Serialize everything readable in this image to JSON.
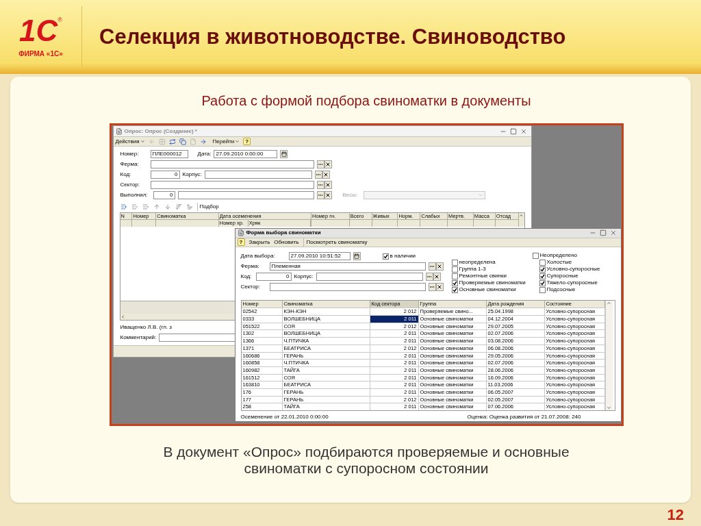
{
  "slide": {
    "logo": {
      "mark": "1С",
      "registered": "®",
      "caption": "ФИРМА «1С»"
    },
    "title": "Селекция в животноводстве. Свиноводство",
    "subtitle": "Работа с формой подбора свиноматки в документы",
    "caption": "В документ «Опрос» подбираются проверяемые и основные свиноматки с супоросном состоянии",
    "page_number": "12"
  },
  "doc": {
    "title": "Опрос: Опрос (Создание) *",
    "actions": "Действия",
    "goto": "Перейти",
    "help": "?",
    "number": {
      "label": "Номер:",
      "value": "ПЛЕ000012"
    },
    "date": {
      "label": "Дата:",
      "value": "27.09.2010  0:00:00"
    },
    "farm": {
      "label": "Ферма:"
    },
    "code": {
      "label": "Код:",
      "value": "0"
    },
    "building": {
      "label": "Корпус:"
    },
    "sector": {
      "label": "Сектор:"
    },
    "performer": {
      "label": "Выполнил:",
      "value": "0"
    },
    "scales": {
      "label": "Весы:",
      "disabled": true
    },
    "selection": "Подбор",
    "columns": [
      {
        "label": "N"
      },
      {
        "label": "Номер"
      },
      {
        "label": "Свиноматка"
      },
      {
        "label": "Дата осеменения",
        "sub": [
          "Номер хр.",
          "Хряк"
        ]
      },
      {
        "label": "Номер гн."
      },
      {
        "label": "Всего"
      },
      {
        "label": "Живых"
      },
      {
        "label": "Норм."
      },
      {
        "label": "Слабых"
      },
      {
        "label": "Мертв."
      },
      {
        "label": "Масса"
      },
      {
        "label": "Отсад"
      }
    ],
    "performer_name": "Иващенко Л.В. (гл. з",
    "comment": {
      "label": "Комментарий:"
    }
  },
  "picker": {
    "title": "Форма выбора свиноматки",
    "help": "?",
    "buttons": [
      "Закрыть",
      "Обновить",
      "Посмотреть свиноматку"
    ],
    "date": {
      "label": "Дата выбора:",
      "value": "27.09.2010 10:51:52"
    },
    "in_stock": {
      "label": "в наличии",
      "checked": true
    },
    "farm": {
      "label": "Ферма:",
      "value": "Племенная"
    },
    "code": {
      "label": "Код:",
      "value": "0"
    },
    "building": {
      "label": "Корпус:"
    },
    "sector": {
      "label": "Сектор:"
    },
    "groups": [
      {
        "label": "неопределена",
        "checked": false
      },
      {
        "label": "Группа 1-3",
        "checked": false
      },
      {
        "label": "Ремонтные свинки",
        "checked": false
      },
      {
        "label": "Проверяемые свиноматки",
        "checked": true
      },
      {
        "label": "Основные свиноматки",
        "checked": true
      }
    ],
    "states": [
      {
        "label": "Неопределено",
        "checked": false
      },
      {
        "label": "Холостые",
        "checked": false
      },
      {
        "label": "Условно-супоросные",
        "checked": true
      },
      {
        "label": "Супоросные",
        "checked": true
      },
      {
        "label": "Тяжело-супоросные",
        "checked": true
      },
      {
        "label": "Подсосные",
        "checked": false
      }
    ],
    "columns": [
      "Номер",
      "Свиноматка",
      "Код сектора",
      "Группа",
      "Дата рождения",
      "Состояние"
    ],
    "rows": [
      {
        "cells": [
          "02542",
          "КЭН-КЭН",
          "2 012",
          "Проверяемые свино...",
          "25.04.1998",
          "Условно-супоросная"
        ],
        "selected": false
      },
      {
        "cells": [
          "0333",
          "ВОЛШЕБНИЦА",
          "2 011",
          "Основные свиноматки",
          "04.12.2004",
          "Условно-супоросная"
        ],
        "selected": true
      },
      {
        "cells": [
          "051522",
          "СОЯ",
          "2 012",
          "Основные свиноматки",
          "29.07.2005",
          "Условно-супоросная"
        ],
        "selected": false
      },
      {
        "cells": [
          "1302",
          "ВОЛШЕБНИЦА",
          "2 011",
          "Основные свиноматки",
          "02.07.2006",
          "Условно-супоросная"
        ],
        "selected": false
      },
      {
        "cells": [
          "1366",
          "Ч.ПТИЧКА",
          "2 011",
          "Основные свиноматки",
          "03.08.2006",
          "Условно-супоросная"
        ],
        "selected": false
      },
      {
        "cells": [
          "1371",
          "БЕАТРИСА",
          "2 012",
          "Основные свиноматки",
          "06.08.2006",
          "Условно-супоросная"
        ],
        "selected": false
      },
      {
        "cells": [
          "160686",
          "ГЕРАНЬ",
          "2 011",
          "Основные свиноматки",
          "29.05.2006",
          "Условно-супоросная"
        ],
        "selected": false
      },
      {
        "cells": [
          "160858",
          "Ч.ПТИЧКА",
          "2 011",
          "Основные свиноматки",
          "02.07.2006",
          "Условно-супоросная"
        ],
        "selected": false
      },
      {
        "cells": [
          "160982",
          "ТАЙГА",
          "2 011",
          "Основные свиноматки",
          "28.06.2006",
          "Условно-супоросная"
        ],
        "selected": false
      },
      {
        "cells": [
          "161512",
          "СОЯ",
          "2 011",
          "Основные свиноматки",
          "16.09.2006",
          "Условно-супоросная"
        ],
        "selected": false
      },
      {
        "cells": [
          "163810",
          "БЕАТРИСА",
          "2 011",
          "Основные свиноматки",
          "11.03.2006",
          "Условно-супоросная"
        ],
        "selected": false
      },
      {
        "cells": [
          "176",
          "ГЕРАНЬ",
          "2 011",
          "Основные свиноматки",
          "06.05.2007",
          "Условно-супоросная"
        ],
        "selected": false
      },
      {
        "cells": [
          "177",
          "ГЕРАНЬ",
          "2 012",
          "Основные свиноматки",
          "02.05.2007",
          "Условно-супоросная"
        ],
        "selected": false
      },
      {
        "cells": [
          "258",
          "ТАЙГА",
          "2 011",
          "Основные свиноматки",
          "07.06.2006",
          "Условно-супоросная"
        ],
        "selected": false
      }
    ],
    "footer_left": "Осеменение от 22.01.2010 0:00:00",
    "footer_right": "Оценка: Оценка развития от 21.07.2008: 240"
  }
}
